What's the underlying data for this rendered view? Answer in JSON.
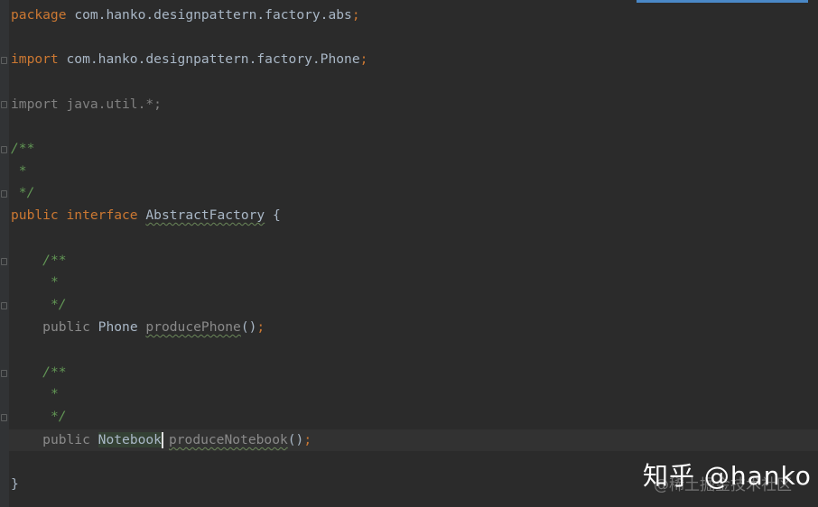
{
  "code": {
    "package_kw": "package",
    "package_name": "com.hanko.designpattern.factory.abs",
    "semicolon": ";",
    "import_kw": "import",
    "import_phone": "com.hanko.designpattern.factory.Phone",
    "import_util": "import java.util.*;",
    "doc_open": "/**",
    "doc_star": "*",
    "doc_close": "*/",
    "public_kw": "public",
    "interface_kw": "interface",
    "interface_name": "AbstractFactory",
    "open_brace": "{",
    "close_brace": "}",
    "method1_type": "Phone",
    "method1_name": "producePhone",
    "method2_type": "Notebook",
    "method2_name": "produceNotebook",
    "parens": "()"
  },
  "watermark": {
    "main": "知乎 @hanko",
    "sub": "@稀土掘金技术社区"
  },
  "colors": {
    "background": "#2b2b2b",
    "keyword": "#cc7832",
    "comment": "#629755",
    "text": "#a9b7c6",
    "unused_import": "#808080",
    "current_line": "#323232",
    "usage_highlight": "#344134"
  }
}
